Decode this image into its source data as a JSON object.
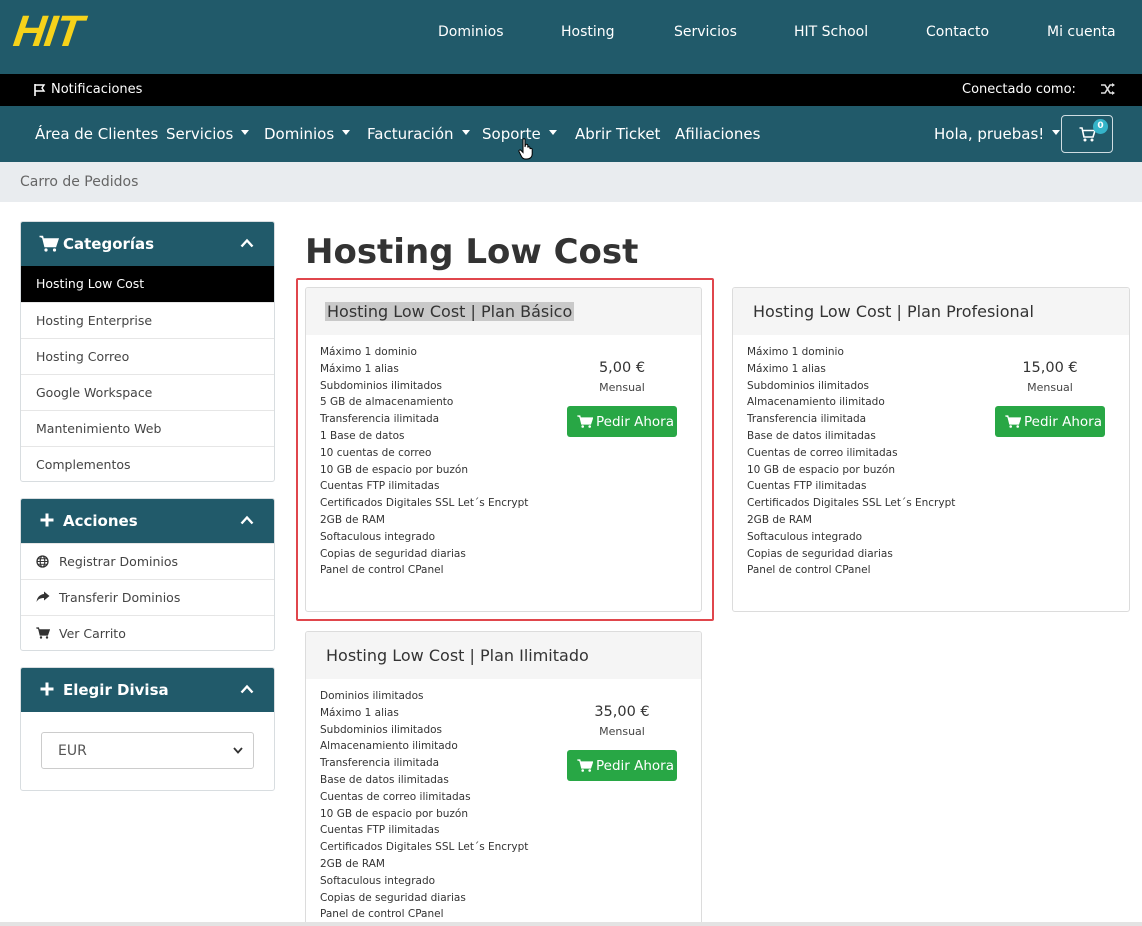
{
  "header": {
    "logo": "HIT",
    "nav": [
      "Dominios",
      "Hosting",
      "Servicios",
      "HIT School",
      "Contacto",
      "Mi cuenta"
    ]
  },
  "notifbar": {
    "notifications": "Notificaciones",
    "connected": "Conectado como:",
    "shuffle_icon": "shuffle-icon"
  },
  "mainnav": {
    "items": [
      {
        "label": "Área de Clientes",
        "dropdown": false
      },
      {
        "label": "Servicios",
        "dropdown": true
      },
      {
        "label": "Dominios",
        "dropdown": true
      },
      {
        "label": "Facturación",
        "dropdown": true
      },
      {
        "label": "Soporte",
        "dropdown": true
      },
      {
        "label": "Abrir Ticket",
        "dropdown": false
      },
      {
        "label": "Afiliaciones",
        "dropdown": false
      }
    ],
    "greeting": "Hola, pruebas!",
    "cart_count": "0"
  },
  "breadcrumb": "Carro de Pedidos",
  "sidebar": {
    "categories": {
      "title": "Categorías",
      "items": [
        "Hosting Low Cost",
        "Hosting Enterprise",
        "Hosting Correo",
        "Google Workspace",
        "Mantenimiento Web",
        "Complementos"
      ],
      "active": "Hosting Low Cost"
    },
    "actions": {
      "title": "Acciones",
      "items": [
        {
          "label": "Registrar Dominios",
          "icon": "globe-icon"
        },
        {
          "label": "Transferir Dominios",
          "icon": "share-arrow-icon"
        },
        {
          "label": "Ver Carrito",
          "icon": "cart-icon"
        }
      ]
    },
    "currency": {
      "title": "Elegir Divisa",
      "selected": "EUR"
    }
  },
  "page_title": "Hosting Low Cost",
  "products": [
    {
      "title": "Hosting Low Cost | Plan Básico",
      "price": "5,00 €",
      "period": "Mensual",
      "button": "Pedir Ahora",
      "features": [
        "Máximo 1 dominio",
        "Máximo 1 alias",
        "Subdominios ilimitados",
        "5 GB de almacenamiento",
        "Transferencia ilimitada",
        "1 Base de datos",
        "10 cuentas de correo",
        "10 GB de espacio por buzón",
        "Cuentas FTP ilimitadas",
        "Certificados Digitales SSL Let´s Encrypt",
        "2GB de RAM",
        "Softaculous integrado",
        "Copias de seguridad diarias",
        "Panel de control CPanel"
      ]
    },
    {
      "title": "Hosting Low Cost | Plan Profesional",
      "price": "15,00 €",
      "period": "Mensual",
      "button": "Pedir Ahora",
      "features": [
        "Máximo 1 dominio",
        "Máximo 1 alias",
        "Subdominios ilimitados",
        "Almacenamiento ilimitado",
        "Transferencia ilimitada",
        "Base de datos ilimitadas",
        "Cuentas de correo ilimitadas",
        "10 GB de espacio por buzón",
        "Cuentas FTP ilimitadas",
        "Certificados Digitales SSL Let´s Encrypt",
        "2GB de RAM",
        "Softaculous integrado",
        "Copias de seguridad diarias",
        "Panel de control CPanel"
      ]
    },
    {
      "title": "Hosting Low Cost | Plan Ilimitado",
      "price": "35,00 €",
      "period": "Mensual",
      "button": "Pedir Ahora",
      "features": [
        "Dominios ilimitados",
        "Máximo 1 alias",
        "Subdominios ilimitados",
        "Almacenamiento ilimitado",
        "Transferencia ilimitada",
        "Base de datos ilimitadas",
        "Cuentas de correo ilimitadas",
        "10 GB de espacio por buzón",
        "Cuentas FTP ilimitadas",
        "Certificados Digitales SSL Let´s Encrypt",
        "2GB de RAM",
        "Softaculous integrado",
        "Copias de seguridad diarias",
        "Panel de control CPanel"
      ]
    }
  ],
  "colors": {
    "brand": "#215a6a",
    "logo": "#f6d21a",
    "order_button": "#28a745",
    "highlight": "#e0464c"
  }
}
